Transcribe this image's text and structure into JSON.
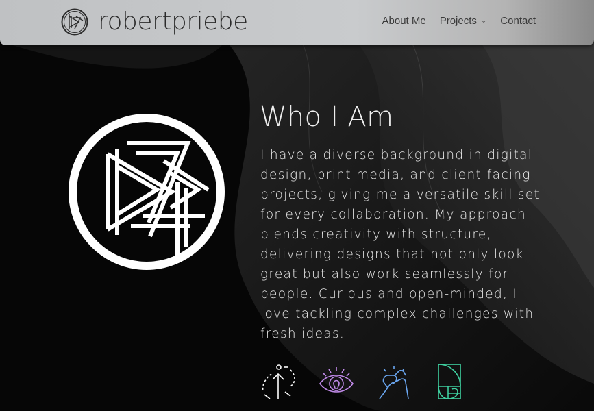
{
  "header": {
    "brand": "robertpriebe",
    "nav": [
      {
        "label": "About Me"
      },
      {
        "label": "Projects",
        "has_dropdown": true
      },
      {
        "label": "Contact"
      }
    ]
  },
  "main": {
    "title": "Who I Am",
    "paragraph": "I have a diverse background in digital design, print media, and client-facing projects, giving me a versatile skill set for every collaboration. My approach blends creativity with structure, delivering designs that not only look great but also work seamlessly for people. Curious and open-minded, I love tackling complex challenges with fresh ideas."
  },
  "icons": [
    {
      "name": "growth-arrow-icon",
      "color": "#ffffff"
    },
    {
      "name": "eye-lightbulb-icon",
      "color": "#c08ae8"
    },
    {
      "name": "handshake-icon",
      "color": "#6aa6f0"
    },
    {
      "name": "golden-ratio-icon",
      "color": "#3fd0a0"
    }
  ],
  "colors": {
    "background": "#060606",
    "header": "#c5c7c9",
    "text": "#e6e6e6"
  }
}
